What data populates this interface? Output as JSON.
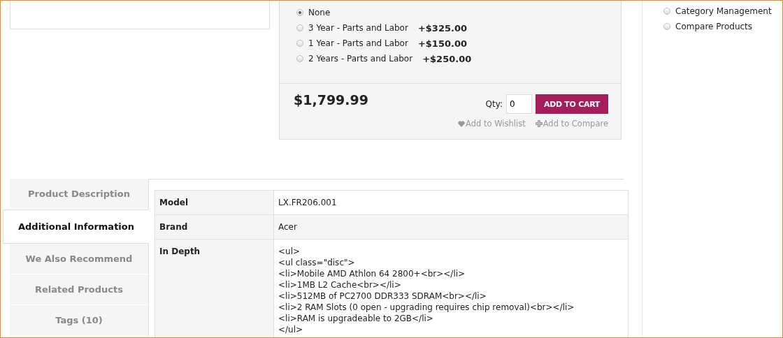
{
  "warranty_options": [
    {
      "label": "None",
      "selected": true
    },
    {
      "label": "3 Year - Parts and Labor",
      "price": "+$325.00",
      "selected": false
    },
    {
      "label": "1 Year - Parts and Labor",
      "price": "+$150.00",
      "selected": false
    },
    {
      "label": "2 Years - Parts and Labor",
      "price": "+$250.00",
      "selected": false
    }
  ],
  "price": "$1,799.99",
  "qty": {
    "label": "Qty:",
    "value": "0"
  },
  "add_to_cart": "ADD TO CART",
  "links": [
    {
      "kind": "wishlist",
      "label": "Add to Wishlist"
    },
    {
      "kind": "compare",
      "label": "Add to Compare"
    }
  ],
  "sidebar": {
    "items": [
      {
        "label": "Category Management",
        "selected": false
      },
      {
        "label": "Compare Products",
        "selected": false
      }
    ]
  },
  "tabs": [
    {
      "label": "Product Description",
      "selected": false
    },
    {
      "label": "Additional Information",
      "selected": true
    },
    {
      "label": "We Also Recommend",
      "selected": false
    },
    {
      "label": "Related Products",
      "selected": false
    },
    {
      "label": "Tags (10)",
      "selected": false
    }
  ],
  "table": {
    "rows": [
      {
        "label": "Model",
        "value": [
          "LX.FR206.001"
        ]
      },
      {
        "label": "Brand",
        "value": [
          "Acer"
        ]
      },
      {
        "label": "In Depth",
        "value": [
          "<ul>",
          "<ul class=\"disc\">",
          "<li>Mobile AMD Athlon 64 2800+<br></li>",
          "<li>1MB L2 Cache<br></li>",
          "<li>512MB of PC2700 DDR333 SDRAM<br></li>",
          "<li>2 RAM Slots (0 open - upgrading requires chip removal)<br></li>",
          "<li>RAM is upgradeable to 2GB</li>",
          "</ul>"
        ]
      }
    ]
  }
}
